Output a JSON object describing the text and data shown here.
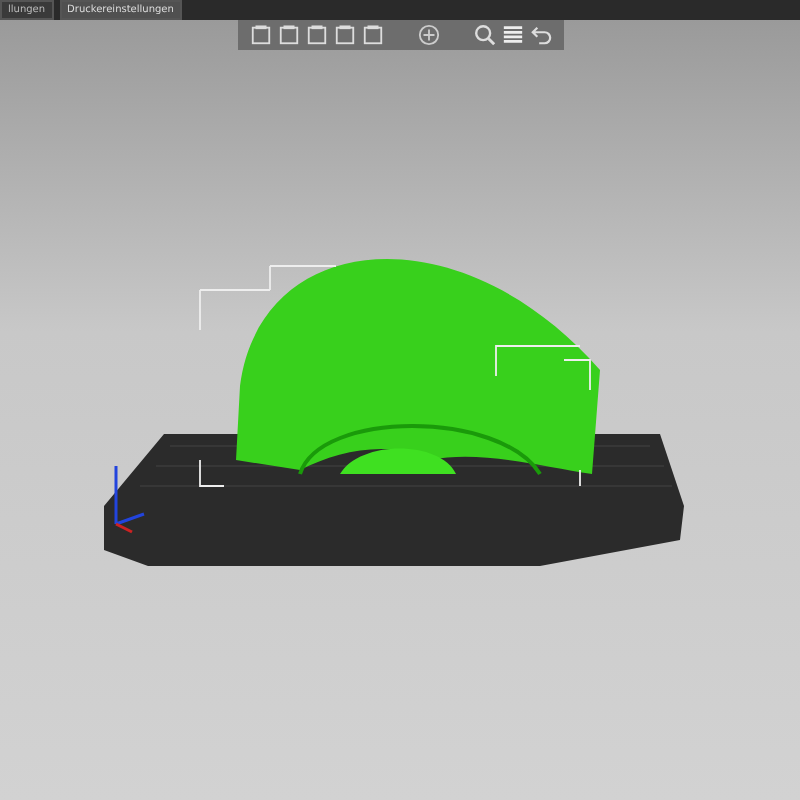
{
  "tabs": [
    {
      "label": "llungen",
      "selected": false
    },
    {
      "label": "Druckereinstellungen",
      "selected": true
    }
  ],
  "toolbar": {
    "buttons": [
      {
        "kind": "box"
      },
      {
        "kind": "box"
      },
      {
        "kind": "box"
      },
      {
        "kind": "box"
      },
      {
        "kind": "box"
      },
      {
        "kind": "plus"
      },
      {
        "kind": "zoom"
      },
      {
        "kind": "layers"
      },
      {
        "kind": "undo"
      }
    ]
  }
}
